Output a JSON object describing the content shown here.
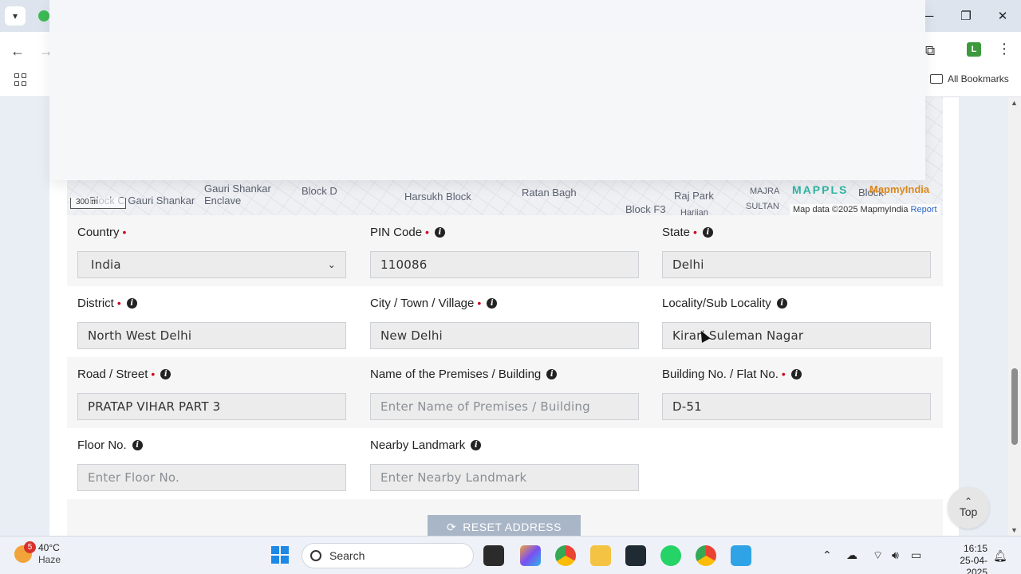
{
  "browser": {
    "bookmarks_label": "All Bookmarks"
  },
  "map": {
    "labels": [
      "Block C Gauri Shankar",
      "Gauri Shankar Enclave",
      "Block D",
      "Harsukh Block",
      "Ratan Bagh",
      "Raj Park",
      "MAJRA",
      "SULTAN",
      "Block F3",
      "Harijan",
      "Block"
    ],
    "scale": "300 m",
    "attribution": "Map data ©2025 MapmyIndia",
    "report_link": "Report",
    "logo_mappls": "MAPPLS",
    "logo_mapmyindia": "MapmyIndia"
  },
  "form": {
    "country": {
      "label": "Country",
      "value": "India"
    },
    "pin_code": {
      "label": "PIN Code",
      "value": "110086"
    },
    "state": {
      "label": "State",
      "value": "Delhi"
    },
    "district": {
      "label": "District",
      "value": "North West Delhi"
    },
    "city": {
      "label": "City / Town / Village",
      "value": "New Delhi"
    },
    "locality": {
      "label": "Locality/Sub Locality",
      "value": "Kirari Suleman Nagar"
    },
    "road": {
      "label": "Road / Street",
      "value": "PRATAP VIHAR PART 3"
    },
    "premises": {
      "label": "Name of the Premises / Building",
      "placeholder": "Enter Name of Premises / Building"
    },
    "building_no": {
      "label": "Building No. / Flat No.",
      "value": "D-51"
    },
    "floor": {
      "label": "Floor No.",
      "placeholder": "Enter Floor No."
    },
    "landmark": {
      "label": "Nearby Landmark",
      "placeholder": "Enter Nearby Landmark"
    },
    "reset_label": "RESET ADDRESS",
    "top_label": "Top"
  },
  "taskbar": {
    "weather_temp": "40°C",
    "weather_desc": "Haze",
    "weather_badge": "5",
    "search_label": "Search",
    "time": "16:15",
    "date": "25-04-2025"
  }
}
